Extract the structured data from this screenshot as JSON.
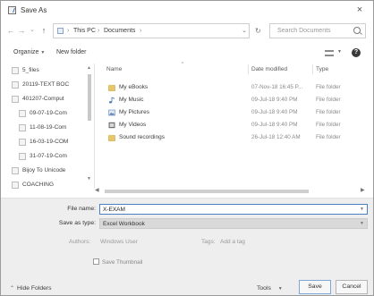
{
  "window": {
    "title": "Save As",
    "close_glyph": "×"
  },
  "navigation": {
    "back_glyph": "←",
    "forward_glyph": "→",
    "recent_glyph": "⌄",
    "up_glyph": "↑",
    "breadcrumb": [
      "This PC",
      "Documents"
    ],
    "breadcrumb_separator": "›",
    "refresh_glyph": "↻",
    "search_placeholder": "Search Documents"
  },
  "toolbar": {
    "organize_label": "Organize",
    "new_folder_label": "New folder",
    "help_glyph": "?"
  },
  "nav_pane": {
    "items": [
      {
        "label": "5_files"
      },
      {
        "label": "20119-TEXT BOC"
      },
      {
        "label": "401207-Comput"
      },
      {
        "label": "09-07-19-Com"
      },
      {
        "label": "11-08-19-Com"
      },
      {
        "label": "16-03-19-COM"
      },
      {
        "label": "31-07-19-Com"
      },
      {
        "label": "Bijoy To Unicode"
      },
      {
        "label": "COACHING"
      }
    ]
  },
  "file_list": {
    "columns": {
      "name": "Name",
      "date_modified": "Date modified",
      "type": "Type"
    },
    "rows": [
      {
        "name": "My eBooks",
        "date": "07-Nov-18 16:45 P...",
        "type": "File folder",
        "icon": "folder-icon"
      },
      {
        "name": "My Music",
        "date": "09-Jul-18 9:40 PM",
        "type": "File folder",
        "icon": "music-icon"
      },
      {
        "name": "My Pictures",
        "date": "09-Jul-18 9:40 PM",
        "type": "File folder",
        "icon": "pictures-icon"
      },
      {
        "name": "My Videos",
        "date": "09-Jul-18 9:40 PM",
        "type": "File folder",
        "icon": "videos-icon"
      },
      {
        "name": "Sound recordings",
        "date": "26-Jul-18 12:40 AM",
        "type": "File folder",
        "icon": "folder-icon"
      }
    ]
  },
  "form": {
    "file_name_label": "File name:",
    "file_name_value": "X-EXAM",
    "save_type_label": "Save as type:",
    "save_type_value": "Excel Workbook",
    "authors_label": "Authors:",
    "authors_value": "Windows User",
    "tags_label": "Tags:",
    "tags_value": "Add a tag",
    "thumbnail_label": "Save Thumbnail"
  },
  "footer": {
    "hide_folders_label": "Hide Folders",
    "tools_label": "Tools",
    "save_label": "Save",
    "cancel_label": "Cancel"
  },
  "colors": {
    "accent": "#4a7fc1",
    "form_background": "#eeeeee"
  }
}
